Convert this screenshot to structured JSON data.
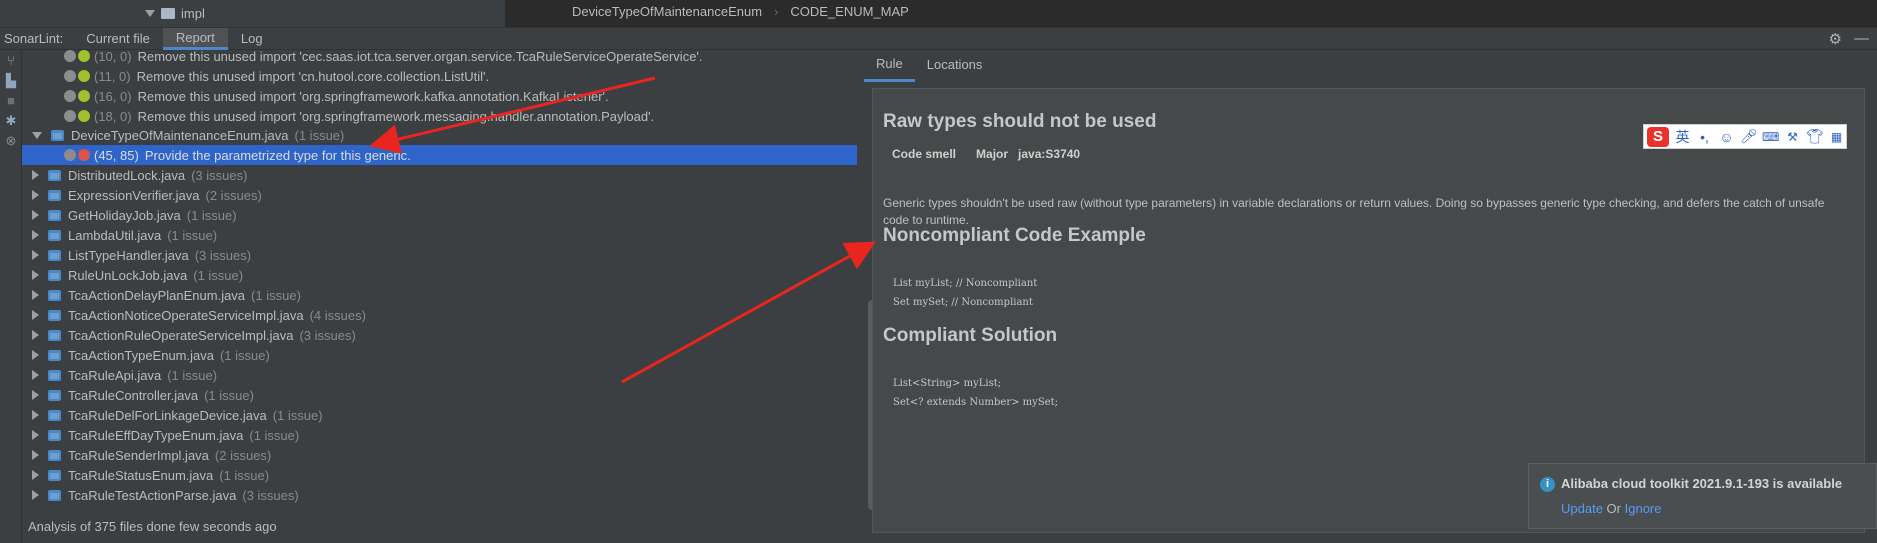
{
  "topbar": {
    "folder_name": "impl",
    "breadcrumb": [
      "DeviceTypeOfMaintenanceEnum",
      "CODE_ENUM_MAP"
    ]
  },
  "toolwindow": {
    "title": "SonarLint:",
    "tabs": [
      "Current file",
      "Report",
      "Log"
    ],
    "active_tab": "Report"
  },
  "tree": {
    "issue_rows": [
      {
        "loc": "(10, 0)",
        "msg": "Remove this unused import 'cec.saas.iot.tca.server.organ.service.TcaRuleServiceOperateService'."
      },
      {
        "loc": "(11, 0)",
        "msg": "Remove this unused import 'cn.hutool.core.collection.ListUtil'."
      },
      {
        "loc": "(16, 0)",
        "msg": "Remove this unused import 'org.springframework.kafka.annotation.KafkaListener'."
      },
      {
        "loc": "(18, 0)",
        "msg": "Remove this unused import 'org.springframework.messaging.handler.annotation.Payload'."
      }
    ],
    "expanded_file": {
      "name": "DeviceTypeOfMaintenanceEnum.java",
      "count": "(1 issue)"
    },
    "selected_issue": {
      "loc": "(45, 85)",
      "msg": "Provide the parametrized type for this generic."
    },
    "files": [
      {
        "name": "DistributedLock.java",
        "count": "(3 issues)"
      },
      {
        "name": "ExpressionVerifier.java",
        "count": "(2 issues)"
      },
      {
        "name": "GetHolidayJob.java",
        "count": "(1 issue)"
      },
      {
        "name": "LambdaUtil.java",
        "count": "(1 issue)"
      },
      {
        "name": "ListTypeHandler.java",
        "count": "(3 issues)"
      },
      {
        "name": "RuleUnLockJob.java",
        "count": "(1 issue)"
      },
      {
        "name": "TcaActionDelayPlanEnum.java",
        "count": "(1 issue)"
      },
      {
        "name": "TcaActionNoticeOperateServiceImpl.java",
        "count": "(4 issues)"
      },
      {
        "name": "TcaActionRuleOperateServiceImpl.java",
        "count": "(3 issues)"
      },
      {
        "name": "TcaActionTypeEnum.java",
        "count": "(1 issue)"
      },
      {
        "name": "TcaRuleApi.java",
        "count": "(1 issue)"
      },
      {
        "name": "TcaRuleController.java",
        "count": "(1 issue)"
      },
      {
        "name": "TcaRuleDelForLinkageDevice.java",
        "count": "(1 issue)"
      },
      {
        "name": "TcaRuleEffDayTypeEnum.java",
        "count": "(1 issue)"
      },
      {
        "name": "TcaRuleSenderImpl.java",
        "count": "(2 issues)"
      },
      {
        "name": "TcaRuleStatusEnum.java",
        "count": "(1 issue)"
      },
      {
        "name": "TcaRuleTestActionParse.java",
        "count": "(3 issues)"
      }
    ]
  },
  "status": "Analysis of 375 files done few seconds ago",
  "detail": {
    "tabs": [
      "Rule",
      "Locations"
    ],
    "active_tab": "Rule",
    "title": "Raw types should not be used",
    "type": "Code smell",
    "severity": "Major",
    "rule_key": "java:S3740",
    "description": "Generic types shouldn't be used raw (without type parameters) in variable declarations or return values. Doing so bypasses generic type checking, and defers the catch of unsafe code to runtime.",
    "noncompliant_heading": "Noncompliant Code Example",
    "noncompliant_code": "List myList; // Noncompliant\nSet mySet; // Noncompliant",
    "compliant_heading": "Compliant Solution",
    "compliant_code": "List<String> myList;\nSet<? extends Number> mySet;"
  },
  "ime": {
    "lang": "英"
  },
  "notification": {
    "title": "Alibaba cloud toolkit 2021.9.1-193 is available",
    "update": "Update",
    "or": "Or",
    "ignore": "Ignore"
  },
  "colors": {
    "background": "#3c3f41",
    "selection": "#2f65ca",
    "accent": "#4a88c7",
    "annotation_arrow": "#e8261f"
  }
}
